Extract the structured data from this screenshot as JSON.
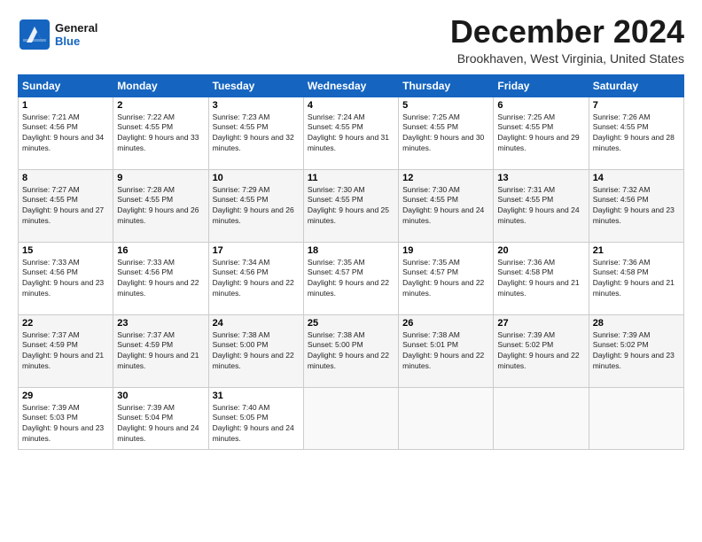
{
  "header": {
    "logo_general": "General",
    "logo_blue": "Blue",
    "month": "December 2024",
    "location": "Brookhaven, West Virginia, United States"
  },
  "days_of_week": [
    "Sunday",
    "Monday",
    "Tuesday",
    "Wednesday",
    "Thursday",
    "Friday",
    "Saturday"
  ],
  "weeks": [
    [
      {
        "day": "1",
        "sunrise": "7:21 AM",
        "sunset": "4:56 PM",
        "daylight": "9 hours and 34 minutes."
      },
      {
        "day": "2",
        "sunrise": "7:22 AM",
        "sunset": "4:55 PM",
        "daylight": "9 hours and 33 minutes."
      },
      {
        "day": "3",
        "sunrise": "7:23 AM",
        "sunset": "4:55 PM",
        "daylight": "9 hours and 32 minutes."
      },
      {
        "day": "4",
        "sunrise": "7:24 AM",
        "sunset": "4:55 PM",
        "daylight": "9 hours and 31 minutes."
      },
      {
        "day": "5",
        "sunrise": "7:25 AM",
        "sunset": "4:55 PM",
        "daylight": "9 hours and 30 minutes."
      },
      {
        "day": "6",
        "sunrise": "7:25 AM",
        "sunset": "4:55 PM",
        "daylight": "9 hours and 29 minutes."
      },
      {
        "day": "7",
        "sunrise": "7:26 AM",
        "sunset": "4:55 PM",
        "daylight": "9 hours and 28 minutes."
      }
    ],
    [
      {
        "day": "8",
        "sunrise": "7:27 AM",
        "sunset": "4:55 PM",
        "daylight": "9 hours and 27 minutes."
      },
      {
        "day": "9",
        "sunrise": "7:28 AM",
        "sunset": "4:55 PM",
        "daylight": "9 hours and 26 minutes."
      },
      {
        "day": "10",
        "sunrise": "7:29 AM",
        "sunset": "4:55 PM",
        "daylight": "9 hours and 26 minutes."
      },
      {
        "day": "11",
        "sunrise": "7:30 AM",
        "sunset": "4:55 PM",
        "daylight": "9 hours and 25 minutes."
      },
      {
        "day": "12",
        "sunrise": "7:30 AM",
        "sunset": "4:55 PM",
        "daylight": "9 hours and 24 minutes."
      },
      {
        "day": "13",
        "sunrise": "7:31 AM",
        "sunset": "4:55 PM",
        "daylight": "9 hours and 24 minutes."
      },
      {
        "day": "14",
        "sunrise": "7:32 AM",
        "sunset": "4:56 PM",
        "daylight": "9 hours and 23 minutes."
      }
    ],
    [
      {
        "day": "15",
        "sunrise": "7:33 AM",
        "sunset": "4:56 PM",
        "daylight": "9 hours and 23 minutes."
      },
      {
        "day": "16",
        "sunrise": "7:33 AM",
        "sunset": "4:56 PM",
        "daylight": "9 hours and 22 minutes."
      },
      {
        "day": "17",
        "sunrise": "7:34 AM",
        "sunset": "4:56 PM",
        "daylight": "9 hours and 22 minutes."
      },
      {
        "day": "18",
        "sunrise": "7:35 AM",
        "sunset": "4:57 PM",
        "daylight": "9 hours and 22 minutes."
      },
      {
        "day": "19",
        "sunrise": "7:35 AM",
        "sunset": "4:57 PM",
        "daylight": "9 hours and 22 minutes."
      },
      {
        "day": "20",
        "sunrise": "7:36 AM",
        "sunset": "4:58 PM",
        "daylight": "9 hours and 21 minutes."
      },
      {
        "day": "21",
        "sunrise": "7:36 AM",
        "sunset": "4:58 PM",
        "daylight": "9 hours and 21 minutes."
      }
    ],
    [
      {
        "day": "22",
        "sunrise": "7:37 AM",
        "sunset": "4:59 PM",
        "daylight": "9 hours and 21 minutes."
      },
      {
        "day": "23",
        "sunrise": "7:37 AM",
        "sunset": "4:59 PM",
        "daylight": "9 hours and 21 minutes."
      },
      {
        "day": "24",
        "sunrise": "7:38 AM",
        "sunset": "5:00 PM",
        "daylight": "9 hours and 22 minutes."
      },
      {
        "day": "25",
        "sunrise": "7:38 AM",
        "sunset": "5:00 PM",
        "daylight": "9 hours and 22 minutes."
      },
      {
        "day": "26",
        "sunrise": "7:38 AM",
        "sunset": "5:01 PM",
        "daylight": "9 hours and 22 minutes."
      },
      {
        "day": "27",
        "sunrise": "7:39 AM",
        "sunset": "5:02 PM",
        "daylight": "9 hours and 22 minutes."
      },
      {
        "day": "28",
        "sunrise": "7:39 AM",
        "sunset": "5:02 PM",
        "daylight": "9 hours and 23 minutes."
      }
    ],
    [
      {
        "day": "29",
        "sunrise": "7:39 AM",
        "sunset": "5:03 PM",
        "daylight": "9 hours and 23 minutes."
      },
      {
        "day": "30",
        "sunrise": "7:39 AM",
        "sunset": "5:04 PM",
        "daylight": "9 hours and 24 minutes."
      },
      {
        "day": "31",
        "sunrise": "7:40 AM",
        "sunset": "5:05 PM",
        "daylight": "9 hours and 24 minutes."
      },
      {
        "day": "",
        "sunrise": "",
        "sunset": "",
        "daylight": ""
      },
      {
        "day": "",
        "sunrise": "",
        "sunset": "",
        "daylight": ""
      },
      {
        "day": "",
        "sunrise": "",
        "sunset": "",
        "daylight": ""
      },
      {
        "day": "",
        "sunrise": "",
        "sunset": "",
        "daylight": ""
      }
    ]
  ]
}
